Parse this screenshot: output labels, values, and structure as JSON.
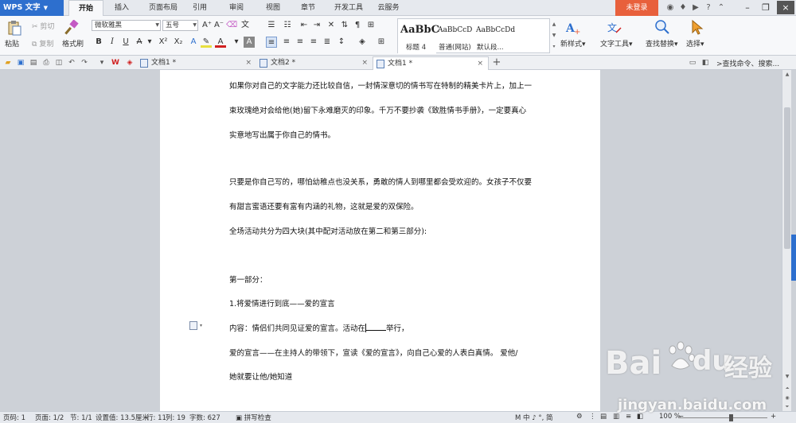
{
  "app": {
    "logo": "WPS 文字",
    "login": "未登录"
  },
  "ribbon_tabs": [
    "开始",
    "插入",
    "页面布局",
    "引用",
    "审阅",
    "视图",
    "章节",
    "开发工具",
    "云服务"
  ],
  "ribbon": {
    "paste": "粘贴",
    "cut": "剪切",
    "copy": "复制",
    "format_painter": "格式刷",
    "font_name": "微软雅黑",
    "font_size": "五号",
    "styles": [
      {
        "preview": "AaBbC",
        "label": "标题 4"
      },
      {
        "preview": "AaBbCcD",
        "label": "普通(网站)"
      },
      {
        "preview": "AaBbCcDd",
        "label": "默认段..."
      }
    ],
    "new_style": "新样式",
    "text_tools": "文字工具",
    "find_replace": "查找替换",
    "select": "选择"
  },
  "doc_tabs": [
    {
      "label": "文档1 *",
      "close": "×"
    },
    {
      "label": "文档2 *",
      "close": "×"
    },
    {
      "label": "文档1 *",
      "close": "×"
    }
  ],
  "new_tab": "+",
  "search_cmd": ">查找命令、搜索...",
  "document": {
    "lines": [
      "如果你对自己的文字能力还比较自信，一封情深意切的情书写在特制的精美卡片上，加上一",
      "束玫瑰绝对会给他(她)留下永难磨灭的印象。千万不要抄袭《致胜情书手册》，一定要真心",
      "实意地写出属于你自己的情书。",
      "只要是你自己写的，哪怕幼稚点也没关系，勇敢的情人到哪里都会受欢迎的。女孩子不仅要",
      "有甜言蜜语还要有富有内涵的礼物，这就是爱的双保险。",
      "全场活动共分为四大块(其中配对活动放在第二和第三部分):",
      "第一部分：",
      "1.将爱情进行到底——爱的宣言"
    ],
    "content_prefix": "内容：情侣们共同见证爱的宣言。活动在",
    "content_suffix": "举行，",
    "lines2": [
      "爱的宣言——在主持人的带领下，宣读《爱的宣言》，向自己心爱的人表白真情。  爱他/",
      "她就要让他/她知道"
    ]
  },
  "status": {
    "page_code": "页码: 1",
    "page": "页面: 1/2",
    "section": "节: 1/1",
    "setting": "设置值: 13.5厘米",
    "row": "行: 11",
    "col": "列: 19",
    "chars": "字数: 627",
    "spellcheck": "拼写检查",
    "zoom": "100 %",
    "ime": "M 中 ♪ °, 简"
  },
  "watermark": {
    "text": "Bai",
    "text2": "du",
    "text3": "经验",
    "url": "jingyan.baidu.com"
  }
}
